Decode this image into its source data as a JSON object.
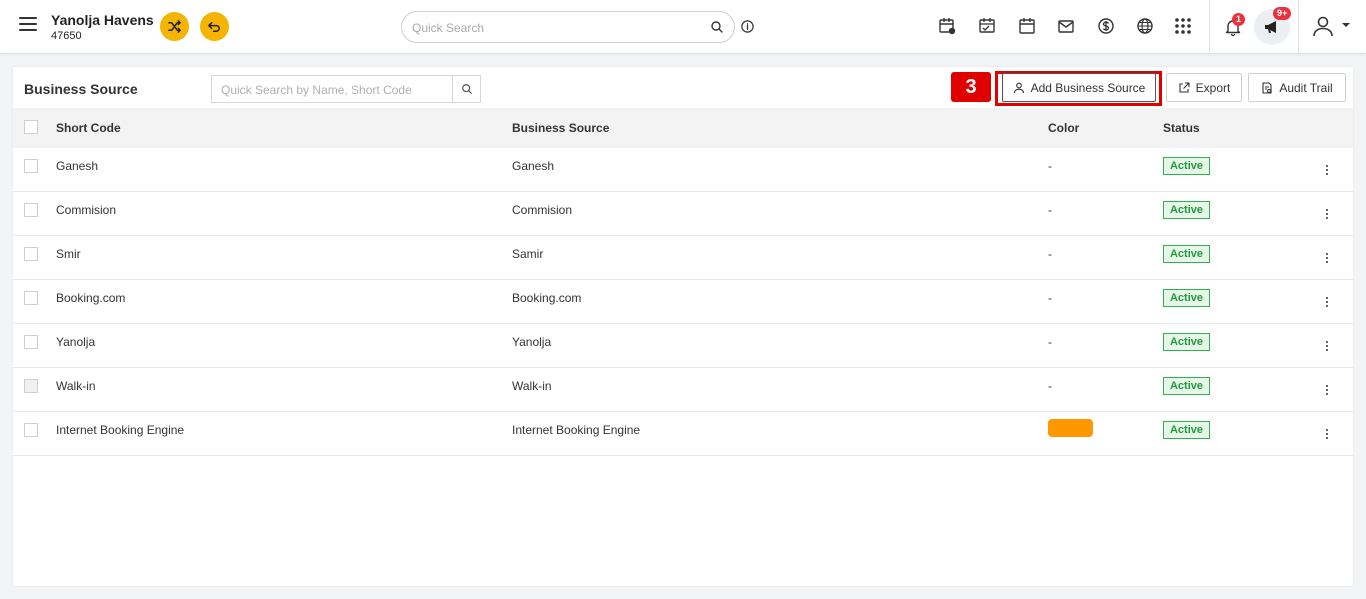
{
  "header": {
    "hotel_name": "Yanolja Havens",
    "hotel_id": "47650",
    "search_placeholder": "Quick Search",
    "notification_count": "1",
    "announcement_count": "9+",
    "accent_color": "#f5b400"
  },
  "toolbar": {
    "title": "Business Source",
    "search_placeholder": "Quick Search by Name, Short Code",
    "step_label": "3",
    "add_label": "Add Business Source",
    "export_label": "Export",
    "audit_label": "Audit Trail"
  },
  "table": {
    "headers": {
      "short_code": "Short Code",
      "business_source": "Business Source",
      "color": "Color",
      "status": "Status"
    },
    "rows": [
      {
        "short_code": "Ganesh",
        "business_source": "Ganesh",
        "color": "-",
        "status": "Active"
      },
      {
        "short_code": "Commision",
        "business_source": "Commision",
        "color": "-",
        "status": "Active"
      },
      {
        "short_code": "Smir",
        "business_source": "Samir",
        "color": "-",
        "status": "Active"
      },
      {
        "short_code": "Booking.com",
        "business_source": "Booking.com",
        "color": "-",
        "status": "Active"
      },
      {
        "short_code": "Yanolja",
        "business_source": "Yanolja",
        "color": "-",
        "status": "Active"
      },
      {
        "short_code": "Walk-in",
        "business_source": "Walk-in",
        "color": "-",
        "status": "Active"
      },
      {
        "short_code": "Internet Booking Engine",
        "business_source": "Internet Booking Engine",
        "color": "",
        "color_swatch": "#ff9800",
        "status": "Active"
      }
    ]
  }
}
